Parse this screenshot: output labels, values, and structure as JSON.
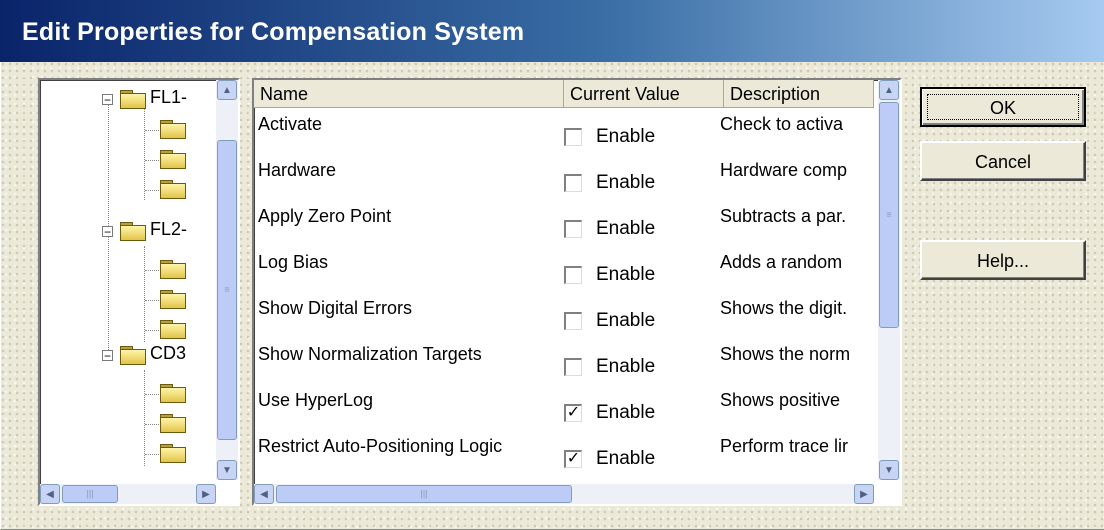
{
  "window": {
    "title": "Edit Properties for Compensation System"
  },
  "tree": {
    "nodes": [
      {
        "label": "FL1-",
        "children": 3
      },
      {
        "label": "FL2-",
        "children": 3
      },
      {
        "label": "CD3",
        "children": 3
      }
    ]
  },
  "grid": {
    "columns": [
      "Name",
      "Current Value",
      "Description"
    ],
    "rows": [
      {
        "name": "Activate",
        "value": "Enable",
        "checked": false,
        "description": "Check to activa"
      },
      {
        "name": "Hardware",
        "value": "Enable",
        "checked": false,
        "description": "Hardware comp"
      },
      {
        "name": "Apply Zero Point",
        "value": "Enable",
        "checked": false,
        "description": "Subtracts a par."
      },
      {
        "name": "Log Bias",
        "value": "Enable",
        "checked": false,
        "description": "Adds a random"
      },
      {
        "name": "Show Digital Errors",
        "value": "Enable",
        "checked": false,
        "description": "Shows the digit."
      },
      {
        "name": "Show Normalization Targets",
        "value": "Enable",
        "checked": false,
        "description": "Shows the norm"
      },
      {
        "name": "Use HyperLog",
        "value": "Enable",
        "checked": true,
        "description": "Shows positive"
      },
      {
        "name": "Restrict Auto-Positioning Logic",
        "value": "Enable",
        "checked": true,
        "description": "Perform trace lir"
      }
    ]
  },
  "buttons": {
    "ok": "OK",
    "cancel": "Cancel",
    "help": "Help..."
  },
  "icons": {
    "expand": "minus-box-icon",
    "folder": "folder-icon",
    "scroll_up": "arrow-up-icon",
    "scroll_down": "arrow-down-icon",
    "scroll_left": "arrow-left-icon",
    "scroll_right": "arrow-right-icon"
  }
}
